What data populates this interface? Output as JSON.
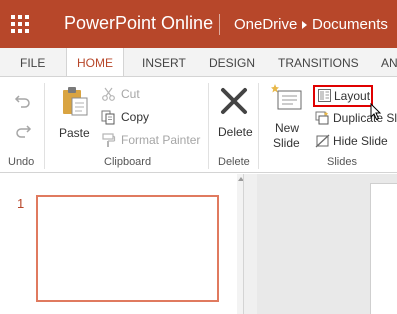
{
  "app": {
    "title": "PowerPoint Online",
    "breadcrumb": [
      "OneDrive",
      "Documents"
    ]
  },
  "tabs": [
    {
      "label": "FILE",
      "active": false
    },
    {
      "label": "HOME",
      "active": true
    },
    {
      "label": "INSERT",
      "active": false
    },
    {
      "label": "DESIGN",
      "active": false
    },
    {
      "label": "TRANSITIONS",
      "active": false
    },
    {
      "label": "AN",
      "active": false
    }
  ],
  "ribbon": {
    "undo_group": {
      "label": "Undo",
      "undo_icon": "undo-icon",
      "redo_icon": "redo-icon"
    },
    "clipboard_group": {
      "label": "Clipboard",
      "paste": "Paste",
      "cut": "Cut",
      "copy": "Copy",
      "format_painter": "Format Painter"
    },
    "delete_group": {
      "label": "Delete",
      "delete": "Delete"
    },
    "slides_group": {
      "label": "Slides",
      "new_slide_line1": "New",
      "new_slide_line2": "Slide",
      "layout": "Layout",
      "duplicate_slide": "Duplicate Sli",
      "hide_slide": "Hide Slide"
    }
  },
  "slides_pane": {
    "slides": [
      {
        "number": "1",
        "selected": true
      }
    ]
  },
  "colors": {
    "brand": "#b7472a",
    "highlight_box": "#e00000",
    "selected_slide_border": "#e07a5f"
  }
}
